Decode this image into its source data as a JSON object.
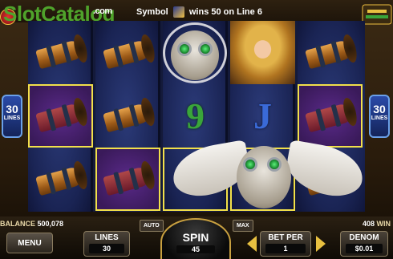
{
  "banner": {
    "logo_text": "SlotCatalog",
    "logo_suffix": ".com",
    "win_prefix": "Symbol",
    "win_symbol_icon": "horn-symbol-icon",
    "win_suffix": "wins 50 on Line 6"
  },
  "lines_badge": {
    "left_number": "30",
    "left_label": "LINES",
    "right_number": "30",
    "right_label": "LINES"
  },
  "reels": [
    [
      "horn",
      "horn-purple",
      "horn"
    ],
    [
      "horn",
      "horn",
      "horn-purple"
    ],
    [
      "owl",
      "nine",
      "owl-wing"
    ],
    [
      "lady",
      "jack",
      "owl"
    ],
    [
      "horn",
      "horn-purple",
      "horn"
    ]
  ],
  "status": {
    "balance_label": "BALANCE",
    "balance_value": "500,078",
    "win_value": "408",
    "win_label": "WIN"
  },
  "controls": {
    "menu_label": "MENU",
    "lines_label": "LINES",
    "lines_value": "30",
    "auto_label": "AUTO",
    "spin_label": "SPIN",
    "spin_value": "45",
    "max_label": "MAX",
    "bet_label": "BET PER",
    "bet_value": "1",
    "denom_label": "DENOM",
    "denom_value": "$0.01"
  },
  "colors": {
    "highlight": "#f2e04a",
    "logo_green": "#4fa32b",
    "accent_gold": "#e8c040"
  }
}
